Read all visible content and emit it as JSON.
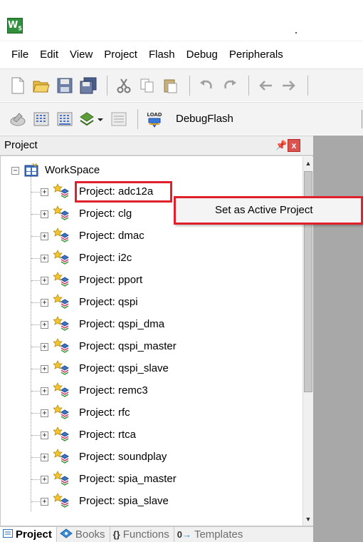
{
  "app": {
    "icon_letter": "W",
    "icon_sub": "5"
  },
  "menubar": {
    "items": [
      "File",
      "Edit",
      "View",
      "Project",
      "Flash",
      "Debug",
      "Peripherals"
    ]
  },
  "toolbar2": {
    "load_label": "LOAD",
    "target": "DebugFlash"
  },
  "pane": {
    "title": "Project",
    "pin_icon": "pin-icon",
    "close_icon": "close-icon",
    "close_glyph": "x"
  },
  "tree": {
    "root": "WorkSpace",
    "projects": [
      "Project: adc12a",
      "Project: clg",
      "Project: dmac",
      "Project: i2c",
      "Project: pport",
      "Project: qspi",
      "Project: qspi_dma",
      "Project: qspi_master",
      "Project: qspi_slave",
      "Project: remc3",
      "Project: rfc",
      "Project: rtca",
      "Project: soundplay",
      "Project: spia_master",
      "Project: spia_slave"
    ],
    "highlighted_project": "Project: adc12a"
  },
  "context_menu": {
    "items": [
      "Set as Active Project"
    ]
  },
  "tabs": {
    "items": [
      {
        "label": "Project",
        "icon": "project-tab-icon",
        "active": true
      },
      {
        "label": "Books",
        "icon": "books-tab-icon",
        "active": false
      },
      {
        "label": "Functions",
        "icon": "functions-tab-icon",
        "active": false
      },
      {
        "label": "Templates",
        "icon": "templates-tab-icon",
        "active": false
      }
    ]
  },
  "colors": {
    "highlight_red": "#e0202a",
    "editor_gray": "#a8a8a8",
    "pane_bg": "#ffffff"
  }
}
